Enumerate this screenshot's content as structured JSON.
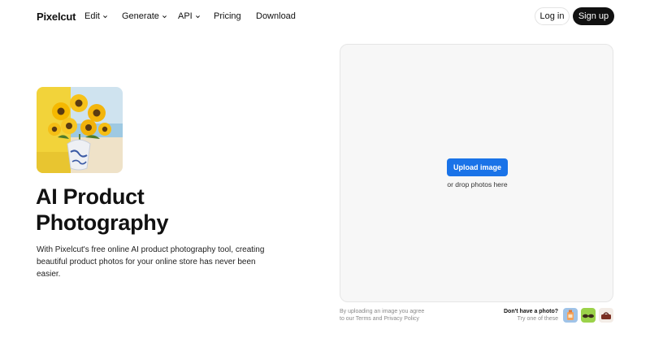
{
  "nav": {
    "logo": "Pixelcut",
    "items": [
      {
        "label": "Edit",
        "has_dropdown": true
      },
      {
        "label": "Generate",
        "has_dropdown": true
      },
      {
        "label": "API",
        "has_dropdown": true
      },
      {
        "label": "Pricing",
        "has_dropdown": false
      },
      {
        "label": "Download",
        "has_dropdown": false
      }
    ],
    "login_label": "Log in",
    "signup_label": "Sign up"
  },
  "hero": {
    "title_line1": "AI Product",
    "title_line2": "Photography",
    "description": "With Pixelcut's free online AI product photography tool, creating beautiful product photos for your online store has never been easier."
  },
  "upload": {
    "button_label": "Upload image",
    "drop_text": "or drop photos here",
    "legal_line1": "By uploading an image you agree",
    "legal_prefix": "to our ",
    "terms_label": "Terms",
    "legal_and": " and ",
    "privacy_label": "Privacy Policy"
  },
  "samples": {
    "title": "Don't have a photo?",
    "subtitle": "Try one of these",
    "items": [
      {
        "icon": "perfume-bottle-thumbnail"
      },
      {
        "icon": "sunglasses-thumbnail"
      },
      {
        "icon": "handbag-thumbnail"
      }
    ]
  },
  "colors": {
    "accent": "#1a73e8",
    "signup_bg": "#111111",
    "panel_bg": "#f7f7f7"
  }
}
